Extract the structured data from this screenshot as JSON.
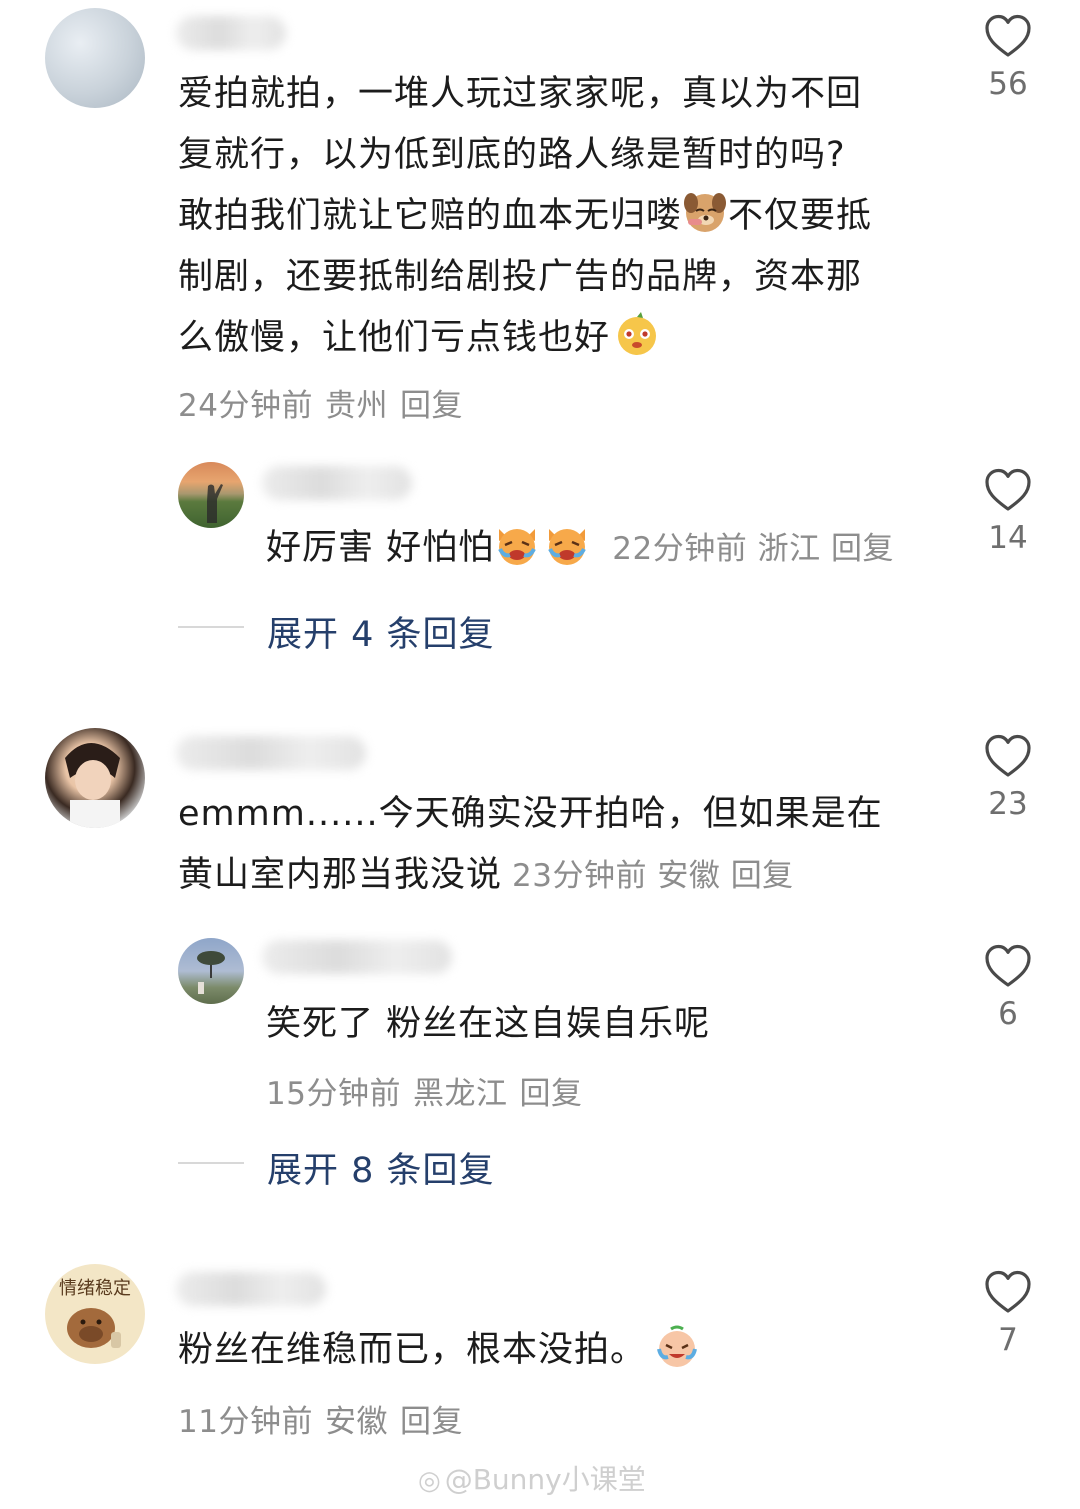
{
  "comments": [
    {
      "text_lines": [
        "爱拍就拍，一堆人玩过家家呢，真以为不回",
        "复就行，以为低到底的路人缘是暂时的吗?",
        "敢拍我们就让它赔的血本无归喽",
        "不仅要抵",
        "制剧，还要抵制给剧投广告的品牌，资本那",
        "么傲慢，让他们亏点钱也好"
      ],
      "time": "24分钟前",
      "location": "贵州",
      "reply": "回复",
      "likes": "56",
      "emojis": [
        "dog-face-emoji",
        "sun-face-emoji"
      ],
      "replies": [
        {
          "text": "好厉害 好怕怕",
          "time": "22分钟前",
          "location": "浙江",
          "reply": "回复",
          "likes": "14",
          "emojis": [
            "crying-cat-emoji",
            "crying-cat-emoji"
          ]
        }
      ],
      "expand_label": "展开 4 条回复"
    },
    {
      "text_lines": [
        "emmm......今天确实没开拍哈，但如果是在",
        "黄山室内那当我没说"
      ],
      "time": "23分钟前",
      "location": "安徽",
      "reply": "回复",
      "likes": "23",
      "replies": [
        {
          "text": "笑死了 粉丝在这自娱自乐呢",
          "time": "15分钟前",
          "location": "黑龙江",
          "reply": "回复",
          "likes": "6"
        }
      ],
      "expand_label": "展开 8 条回复"
    },
    {
      "avatar_text": "情绪稳定",
      "text_lines": [
        "粉丝在维稳而已，根本没拍。"
      ],
      "time": "11分钟前",
      "location": "安徽",
      "reply": "回复",
      "likes": "7",
      "emojis": [
        "laughing-tears-emoji"
      ]
    }
  ],
  "watermark": "@Bunny小课堂",
  "colors": {
    "text": "#1c1c1c",
    "meta": "#8d8d8d",
    "expand_link": "#253f6b",
    "divider": "#d8d8d8"
  }
}
